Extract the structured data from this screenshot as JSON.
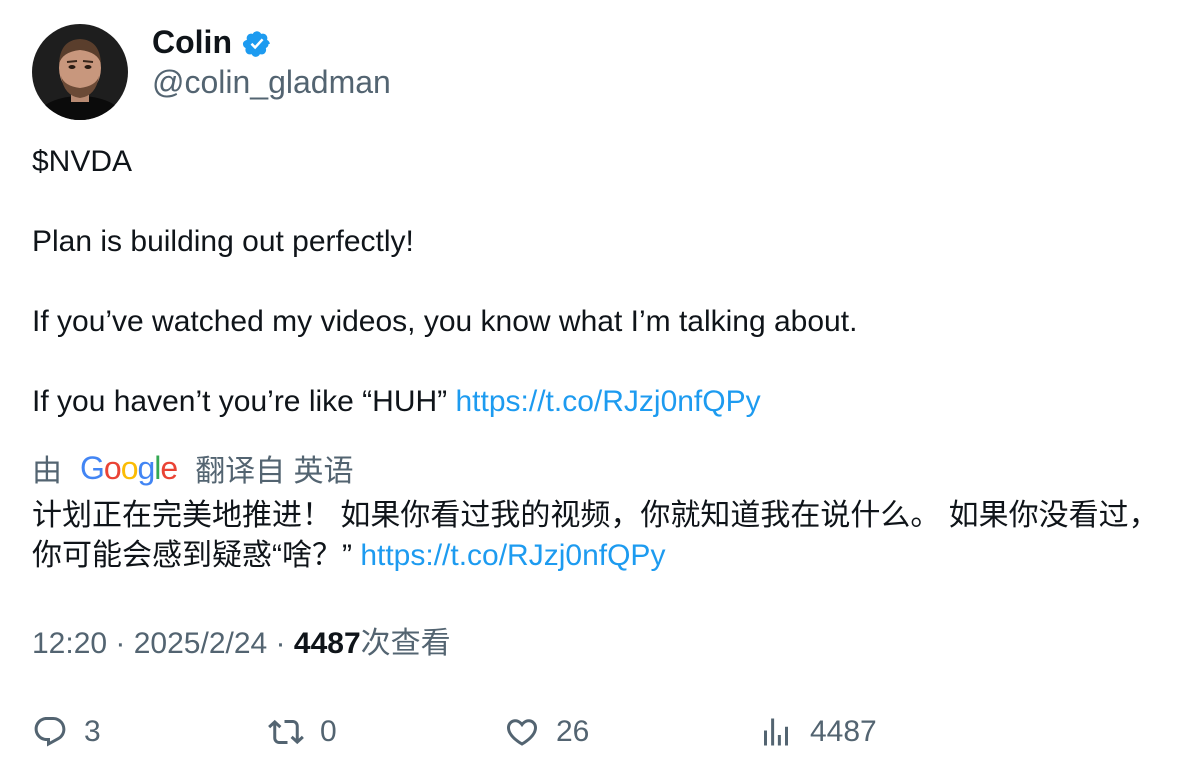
{
  "user": {
    "display_name": "Colin",
    "handle": "@colin_gladman",
    "verified": true,
    "verified_icon": "verified-badge-icon",
    "verified_color": "#1d9bf0"
  },
  "tweet": {
    "line1": "$NVDA",
    "line2": "Plan is building out perfectly!",
    "line3": "If you’ve watched my videos, you know what I’m talking about.",
    "line4_text": "If you haven’t you’re like “HUH” ",
    "link": "https://t.co/RJzj0nfQPy"
  },
  "translation": {
    "prefix": "由",
    "provider_letters": [
      "G",
      "o",
      "o",
      "g",
      "l",
      "e"
    ],
    "suffix": "翻译自 英语",
    "text": "计划正在完美地推进！ 如果你看过我的视频，你就知道我在说什么。 如果你没看过，你可能会感到疑惑“啥？” ",
    "link": "https://t.co/RJzj0nfQPy"
  },
  "meta": {
    "time": "12:20",
    "separator": " · ",
    "date": "2025/2/24",
    "views_count": "4487",
    "views_label": "次查看"
  },
  "actions": {
    "replies": "3",
    "retweets": "0",
    "likes": "26",
    "views": "4487"
  },
  "colors": {
    "link": "#1d9bf0",
    "secondary_text": "#536471",
    "primary_text": "#0f1419"
  }
}
